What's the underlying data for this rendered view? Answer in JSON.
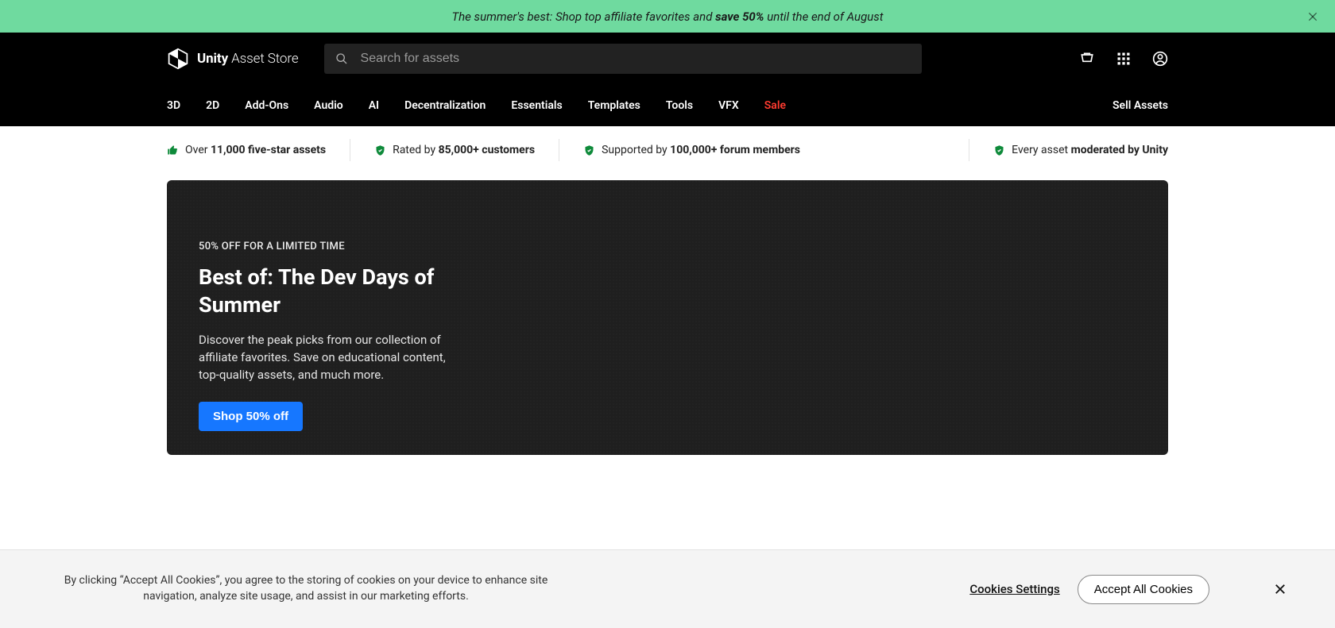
{
  "banner": {
    "text_pre": "The summer's best: Shop top affiliate favorites and ",
    "text_bold": "save 50%",
    "text_post": " until the end of August"
  },
  "logo": {
    "part1": "Unity",
    "part2": " Asset Store"
  },
  "search": {
    "placeholder": "Search for assets"
  },
  "nav": {
    "items": [
      "3D",
      "2D",
      "Add-Ons",
      "Audio",
      "AI",
      "Decentralization",
      "Essentials",
      "Templates",
      "Tools",
      "VFX",
      "Sale"
    ],
    "sell": "Sell Assets"
  },
  "stats": [
    {
      "icon": "thumb",
      "pre": "Over ",
      "bold": "11,000 five-star assets"
    },
    {
      "icon": "shield",
      "pre": "Rated by ",
      "bold": "85,000+ customers"
    },
    {
      "icon": "shield",
      "pre": "Supported by ",
      "bold": "100,000+ forum members"
    },
    {
      "icon": "shield",
      "pre": "Every asset ",
      "bold": "moderated by Unity"
    }
  ],
  "hero": {
    "eyebrow": "50% OFF FOR A LIMITED TIME",
    "title": "Best of: The Dev Days of Summer",
    "body": "Discover the peak picks from our collection of affiliate favorites. Save on educational content, top-quality assets, and much more.",
    "cta": "Shop 50% off"
  },
  "cookies": {
    "text": "By clicking “Accept All Cookies”, you agree to the storing of cookies on your device to enhance site navigation, analyze site usage, and assist in our marketing efforts.",
    "settings": "Cookies Settings",
    "accept": "Accept All Cookies"
  }
}
